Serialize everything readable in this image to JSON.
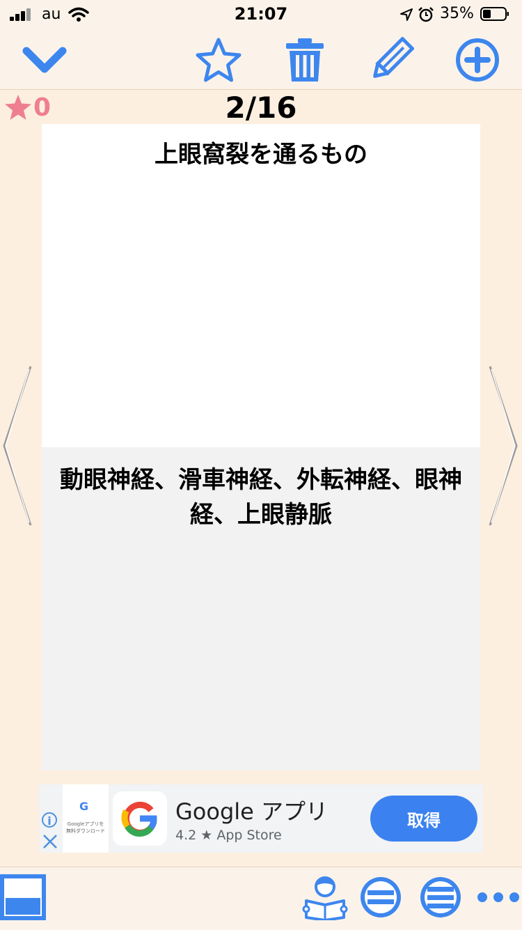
{
  "status_bar": {
    "carrier": "au",
    "time": "21:07",
    "battery": "35%"
  },
  "toolbar": {
    "icons": [
      "chevron-down-icon",
      "star-outline-icon",
      "trash-icon",
      "pencil-icon",
      "plus-circle-icon"
    ],
    "accent_color": "#4a8bf0"
  },
  "card_header": {
    "star_count": "0",
    "progress": "2/16"
  },
  "card": {
    "question": "上眼窩裂を通るもの",
    "answer": "動眼神経、滑車神経、外転神経、眼神経、上眼静脈"
  },
  "ad": {
    "thumb_logo": "G",
    "thumb_caption": "Googleアプリを無料ダウンロード",
    "app_name": "Google アプリ",
    "rating_line": "4.2 ★ App Store",
    "cta_label": "取得"
  },
  "bottom_bar": {
    "icons": [
      "layout-toggle-icon",
      "reading-person-icon",
      "two-lines-circle-icon",
      "three-lines-circle-icon",
      "more-dots-icon"
    ]
  }
}
